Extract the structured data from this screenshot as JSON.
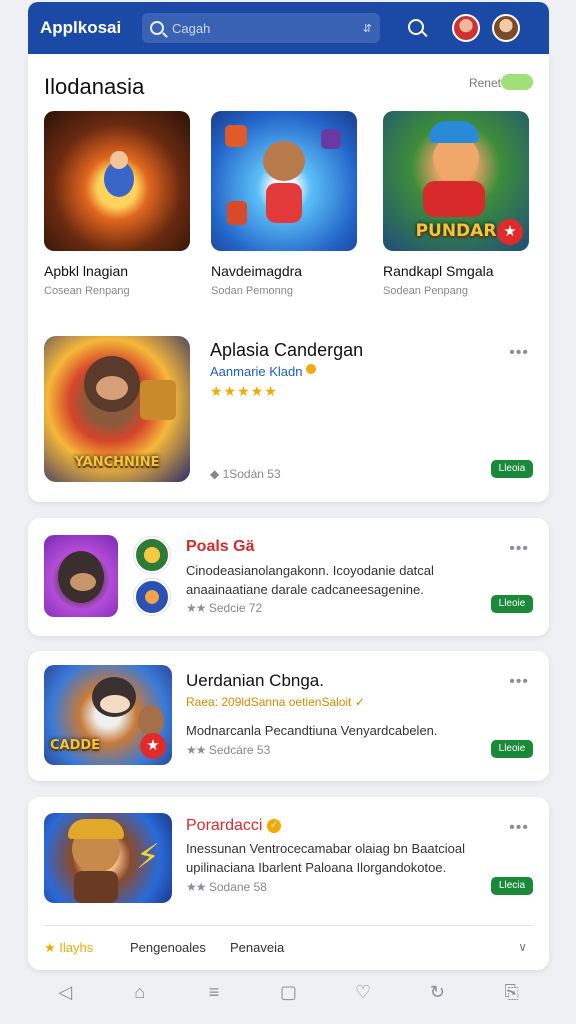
{
  "header": {
    "app_title": "Applkosai",
    "search_placeholder": "Cagah",
    "filter_icon": "filter-icon"
  },
  "featured": {
    "title": "Ilodanasia",
    "see_more": "Renet",
    "items": [
      {
        "name": "Apbkl lnagian",
        "subtitle": "Cosean Renpang"
      },
      {
        "name": "Navdeimagdra",
        "subtitle": "Sodan Pemonng"
      },
      {
        "name": "Randkapl Smgala",
        "subtitle": "Sodean Penpang",
        "thumb_text": "PUNDAR"
      }
    ],
    "highlight": {
      "title": "Aplasia Candergan",
      "subtitle": "Aanmarie Kladn",
      "rating_stars": "★★★★★",
      "downloads": "1Sodán 53",
      "button_label": "Lleoia",
      "thumb_text": "YANCHNINE"
    }
  },
  "list": [
    {
      "title": "Poals Gä",
      "title_color": "#d62b2b",
      "description": "Cinodeasianolangakonn. Icoyodanie datcal anaainaatiane darale cadcaneesagenine.",
      "rating": "Sedcie 72",
      "button_label": "Lleoie"
    },
    {
      "title": "Uerdanian Cbnga.",
      "title_color": "#111111",
      "subtitle": "Raea: 209ldSanna oetienSaloit",
      "description": "Modnarcanla Pecandtiuna Venyardcabelen.",
      "rating": "Sedcáre 53",
      "button_label": "Lleoie",
      "thumb_text": "CADDE"
    },
    {
      "title": "Porardacci",
      "title_color": "#d62b2b",
      "description": "Inessunan Ventrocecamabar olaiag bn Baatcioal upilinaciana Ibarlent Paloana Ilorgandokotoe.",
      "rating": "Sodane 58",
      "button_label": "Llecia"
    }
  ],
  "tabs": [
    {
      "label": "Ilayhs",
      "active": true
    },
    {
      "label": "Pengenoales",
      "active": false
    },
    {
      "label": "Penaveia",
      "active": false
    }
  ],
  "bottom_nav": [
    "back-icon",
    "home-icon",
    "menu-icon",
    "square-icon",
    "heart-icon",
    "refresh-icon",
    "bookmark-icon"
  ]
}
